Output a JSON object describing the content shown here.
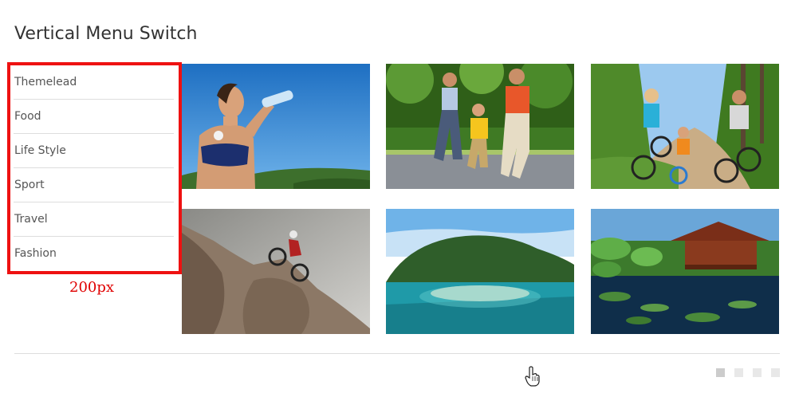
{
  "page": {
    "title": "Vertical Menu Switch"
  },
  "menu": {
    "items": [
      {
        "label": "Themelead"
      },
      {
        "label": "Food"
      },
      {
        "label": "Life Style"
      },
      {
        "label": "Sport"
      },
      {
        "label": "Travel"
      },
      {
        "label": "Fashion"
      }
    ],
    "width_annotation": "200px",
    "highlight_color": "#ee1111"
  },
  "gallery": {
    "photos": [
      {
        "name": "woman-drinking-water-photo"
      },
      {
        "name": "family-running-photo"
      },
      {
        "name": "family-cycling-photo"
      },
      {
        "name": "mountain-biker-photo"
      },
      {
        "name": "tropical-island-photo"
      },
      {
        "name": "thai-house-lotus-pond-photo"
      }
    ]
  },
  "pager": {
    "count": 4,
    "active_index": 0
  }
}
